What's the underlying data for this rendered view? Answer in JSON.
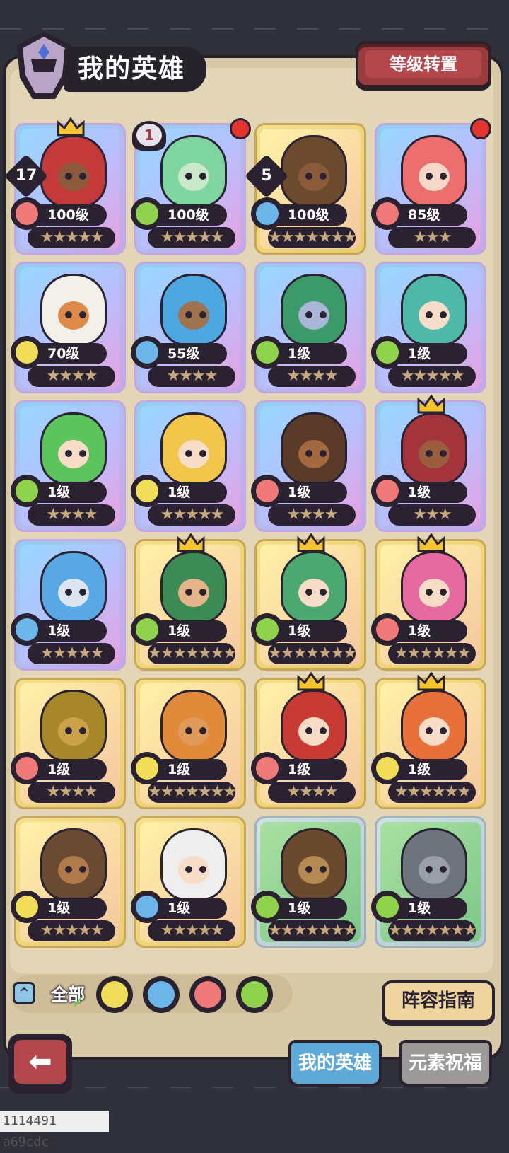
{
  "header": {
    "title": "我的英雄",
    "rank_reset_label": "等级转置"
  },
  "heroes": [
    {
      "level": "100级",
      "element": "fire",
      "stars": "★★★★★",
      "frame": "purple",
      "rank": "17",
      "crown": true,
      "skin": "#8c5a3c",
      "hair": "#c43a3a"
    },
    {
      "level": "100级",
      "element": "wind",
      "stars": "★★★★★",
      "frame": "purple",
      "shield": "1",
      "dot": true,
      "skin": "#c9e8c9",
      "hair": "#7fd6a0"
    },
    {
      "level": "100级",
      "element": "water",
      "stars": "★★★★★★★",
      "frame": "gold",
      "rank": "5",
      "skin": "#8a5a3a",
      "hair": "#6b4a2e"
    },
    {
      "level": "85级",
      "element": "fire",
      "stars": "★★★",
      "frame": "purple",
      "dot": true,
      "skin": "#f7d8c8",
      "hair": "#ec6e6e"
    },
    {
      "level": "70级",
      "element": "earth",
      "stars": "★★★★",
      "frame": "purple",
      "skin": "#e08a4a",
      "hair": "#f3f0ea"
    },
    {
      "level": "55级",
      "element": "water",
      "stars": "★★★★",
      "frame": "purple",
      "skin": "#a0724e",
      "hair": "#4da7e0"
    },
    {
      "level": "1级",
      "element": "wind",
      "stars": "★★★★",
      "frame": "purple",
      "skin": "#a9b6d8",
      "hair": "#3c9a6a"
    },
    {
      "level": "1级",
      "element": "wind",
      "stars": "★★★★★",
      "frame": "purple",
      "skin": "#f7dcc8",
      "hair": "#4fb8a8"
    },
    {
      "level": "1级",
      "element": "wind",
      "stars": "★★★★",
      "frame": "purple",
      "skin": "#f7dcc8",
      "hair": "#5cc45c"
    },
    {
      "level": "1级",
      "element": "earth",
      "stars": "★★★★★",
      "frame": "purple",
      "skin": "#f7dcc8",
      "hair": "#f2c64a"
    },
    {
      "level": "1级",
      "element": "fire",
      "stars": "★★★★",
      "frame": "purple",
      "skin": "#a3683e",
      "hair": "#5a3a28"
    },
    {
      "level": "1级",
      "element": "fire",
      "stars": "★★★",
      "frame": "purple",
      "crown": true,
      "skin": "#9a5e3e",
      "hair": "#a3343c"
    },
    {
      "level": "1级",
      "element": "water",
      "stars": "★★★★★",
      "frame": "purple",
      "skin": "#dbe6f2",
      "hair": "#5aa7e6"
    },
    {
      "level": "1级",
      "element": "wind",
      "stars": "★★★★★★★",
      "frame": "gold",
      "crown": true,
      "skin": "#e6b48a",
      "hair": "#3c8a54"
    },
    {
      "level": "1级",
      "element": "wind",
      "stars": "★★★★★★★",
      "frame": "gold",
      "crown": true,
      "skin": "#f7dcc8",
      "hair": "#4aa870"
    },
    {
      "level": "1级",
      "element": "fire",
      "stars": "★★★★★★",
      "frame": "gold",
      "crown": true,
      "skin": "#f7dcc8",
      "hair": "#e46aa0"
    },
    {
      "level": "1级",
      "element": "fire",
      "stars": "★★★★",
      "frame": "gold",
      "skin": "#c9a24a",
      "hair": "#a8862a"
    },
    {
      "level": "1级",
      "element": "earth",
      "stars": "★★★★★★★",
      "frame": "gold",
      "skin": "#e09a5a",
      "hair": "#e08a3a"
    },
    {
      "level": "1级",
      "element": "fire",
      "stars": "★★★★",
      "frame": "gold",
      "crown": true,
      "skin": "#f7dcc8",
      "hair": "#c83a34"
    },
    {
      "level": "1级",
      "element": "earth",
      "stars": "★★★★★★",
      "frame": "gold",
      "crown": true,
      "skin": "#f7dcc8",
      "hair": "#e8703a"
    },
    {
      "level": "1级",
      "element": "earth",
      "stars": "★★★★★",
      "frame": "gold",
      "skin": "#b07a4a",
      "hair": "#6a4a32"
    },
    {
      "level": "1级",
      "element": "water",
      "stars": "★★★★★",
      "frame": "gold",
      "skin": "#f7dcc8",
      "hair": "#eeeeee"
    },
    {
      "level": "1级",
      "element": "wind",
      "stars": "★★★★★★★",
      "frame": "silver",
      "skin": "#b48a52",
      "hair": "#6a4a2e"
    },
    {
      "level": "1级",
      "element": "wind",
      "stars": "★★★★★★★",
      "frame": "silver",
      "skin": "#9aa0a8",
      "hair": "#6e747c"
    }
  ],
  "filters": {
    "all_label": "全部",
    "elements": [
      "earth",
      "water",
      "fire",
      "wind"
    ]
  },
  "guide_label": "阵容指南",
  "tabs": {
    "my_heroes": "我的英雄",
    "blessing": "元素祝福"
  },
  "footer": {
    "device_text": "1114491 a69cdc"
  },
  "colors": {
    "fire": "#f07a7a",
    "wind": "#8fd34c",
    "water": "#6cb6ea",
    "earth": "#f1dd58"
  }
}
